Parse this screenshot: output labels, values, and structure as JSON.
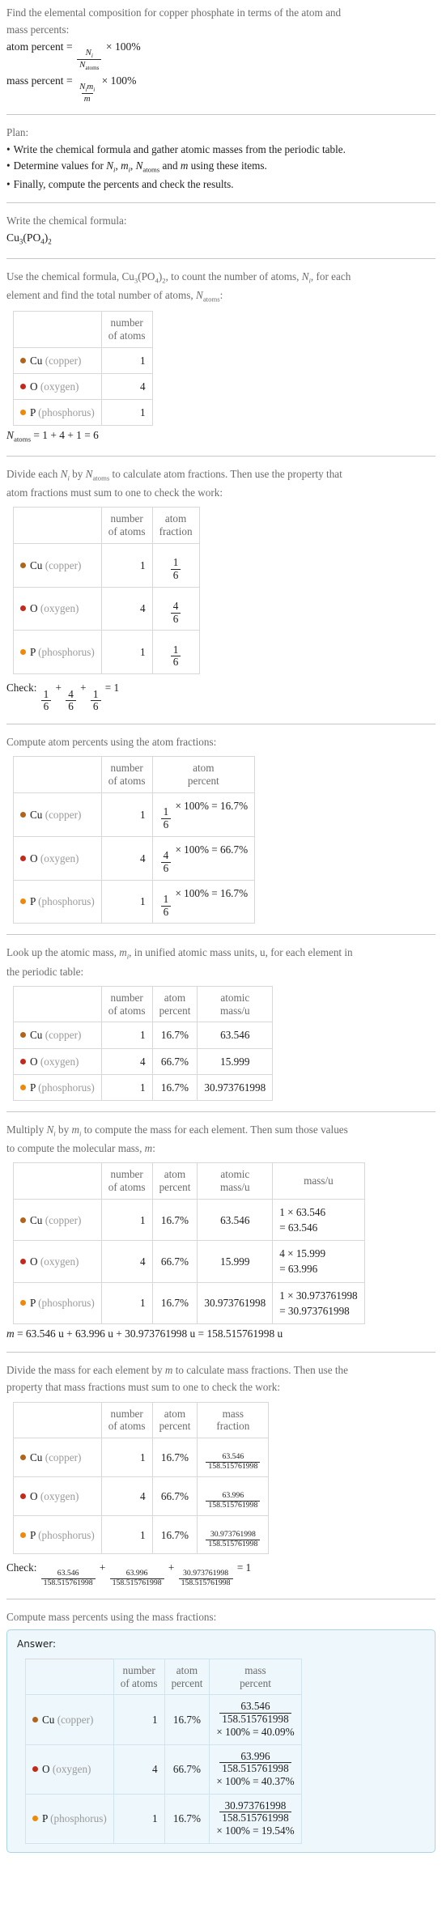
{
  "colors": {
    "cu": "#b0651b",
    "o": "#c32a1b",
    "p": "#ef8a09",
    "pod_bg": "#eef7fb",
    "pod_border": "#a8d4e4"
  },
  "intro": {
    "line1": "Find the elemental composition for copper phosphate in terms of the atom and",
    "line2": "mass percents:",
    "atom_percent_label": "atom percent",
    "mass_percent_label": "mass percent",
    "eq": "=",
    "times100": "× 100%",
    "atom_num": "N",
    "atom_num_sub": "i",
    "atom_den": "N",
    "atom_den_sub": "atoms",
    "mass_num": "N",
    "mass_num_sub": "i",
    "mass_num2": "m",
    "mass_num2_sub": "i",
    "mass_den": "m"
  },
  "plan": {
    "title": "Plan:",
    "items": [
      "Write the chemical formula and gather atomic masses from the periodic table.",
      "Determine values for Ni, mi, Natoms and m using these items.",
      "Finally, compute the percents and check the results."
    ],
    "item2_parts": {
      "a": "Determine values for ",
      "b": "N",
      "b_sub": "i",
      "c": ", ",
      "d": "m",
      "d_sub": "i",
      "e": ", ",
      "f": "N",
      "f_sub": "atoms",
      "g": " and ",
      "h": "m",
      "i": " using these items."
    }
  },
  "step_formula": {
    "prompt": "Write the chemical formula:",
    "formula_parts": [
      "Cu",
      "3",
      "(PO",
      "4",
      ")",
      "2"
    ]
  },
  "step_count": {
    "prompt_a": "Use the chemical formula, ",
    "prompt_b": ", to count the number of atoms, ",
    "prompt_c": ", for each",
    "prompt_d": "element and find the total number of atoms, ",
    "prompt_e": ":",
    "ni": "N",
    "ni_sub": "i",
    "natoms": "N",
    "natoms_sub": "atoms",
    "headers": [
      "",
      "number of atoms"
    ],
    "header_lines": [
      [
        "number",
        "of atoms"
      ]
    ],
    "rows": [
      {
        "dot": "cu",
        "sym": "Cu",
        "name": "(copper)",
        "count": "1"
      },
      {
        "dot": "o",
        "sym": "O",
        "name": "(oxygen)",
        "count": "4"
      },
      {
        "dot": "p",
        "sym": "P",
        "name": "(phosphorus)",
        "count": "1"
      }
    ],
    "total": "= 1 + 4 + 1 = 6",
    "total_sym": "N",
    "total_sym_sub": "atoms"
  },
  "step_fraction": {
    "prompt_a": "Divide each ",
    "prompt_b": " by ",
    "prompt_c": " to calculate atom fractions. Then use the property that",
    "prompt_d": "atom fractions must sum to one to check the work:",
    "ni": "N",
    "ni_sub": "i",
    "natoms": "N",
    "natoms_sub": "atoms",
    "header_atoms": [
      "number",
      "of atoms"
    ],
    "header_fraction": [
      "atom",
      "fraction"
    ],
    "rows": [
      {
        "dot": "cu",
        "sym": "Cu",
        "name": "(copper)",
        "count": "1",
        "num": "1",
        "den": "6"
      },
      {
        "dot": "o",
        "sym": "O",
        "name": "(oxygen)",
        "count": "4",
        "num": "4",
        "den": "6"
      },
      {
        "dot": "p",
        "sym": "P",
        "name": "(phosphorus)",
        "count": "1",
        "num": "1",
        "den": "6"
      }
    ],
    "check_label": "Check:",
    "check_terms": [
      {
        "num": "1",
        "den": "6"
      },
      {
        "num": "4",
        "den": "6"
      },
      {
        "num": "1",
        "den": "6"
      }
    ],
    "check_plus": "+",
    "check_result": "= 1"
  },
  "step_atom_percent": {
    "prompt": "Compute atom percents using the atom fractions:",
    "header_atoms": [
      "number",
      "of atoms"
    ],
    "header_percent": [
      "atom",
      "percent"
    ],
    "rows": [
      {
        "dot": "cu",
        "sym": "Cu",
        "name": "(copper)",
        "count": "1",
        "num": "1",
        "den": "6",
        "expr_tail": "× 100% = 16.7%"
      },
      {
        "dot": "o",
        "sym": "O",
        "name": "(oxygen)",
        "count": "4",
        "num": "4",
        "den": "6",
        "expr_tail": "× 100% = 66.7%"
      },
      {
        "dot": "p",
        "sym": "P",
        "name": "(phosphorus)",
        "count": "1",
        "num": "1",
        "den": "6",
        "expr_tail": "× 100% = 16.7%"
      }
    ]
  },
  "step_atomic_mass": {
    "prompt_a": "Look up the atomic mass, ",
    "prompt_b": ", in unified atomic mass units, u, for each element in",
    "prompt_c": "the periodic table:",
    "mi": "m",
    "mi_sub": "i",
    "header_atoms": [
      "number",
      "of atoms"
    ],
    "header_percent": [
      "atom",
      "percent"
    ],
    "header_mass": [
      "atomic",
      "mass/u"
    ],
    "rows": [
      {
        "dot": "cu",
        "sym": "Cu",
        "name": "(copper)",
        "count": "1",
        "percent": "16.7%",
        "mass": "63.546"
      },
      {
        "dot": "o",
        "sym": "O",
        "name": "(oxygen)",
        "count": "4",
        "percent": "66.7%",
        "mass": "15.999"
      },
      {
        "dot": "p",
        "sym": "P",
        "name": "(phosphorus)",
        "count": "1",
        "percent": "16.7%",
        "mass": "30.973761998"
      }
    ]
  },
  "step_mass": {
    "prompt_a": "Multiply ",
    "prompt_b": " by ",
    "prompt_c": " to compute the mass for each element. Then sum those values",
    "prompt_d": "to compute the molecular mass, ",
    "prompt_e": ":",
    "ni": "N",
    "ni_sub": "i",
    "mi": "m",
    "mi_sub": "i",
    "m": "m",
    "header_atoms": [
      "number",
      "of atoms"
    ],
    "header_percent": [
      "atom",
      "percent"
    ],
    "header_atomic": [
      "atomic",
      "mass/u"
    ],
    "header_massu": [
      "mass/u"
    ],
    "rows": [
      {
        "dot": "cu",
        "sym": "Cu",
        "name": "(copper)",
        "count": "1",
        "percent": "16.7%",
        "atomic": "63.546",
        "calc": "1 × 63.546",
        "calc2": "= 63.546"
      },
      {
        "dot": "o",
        "sym": "O",
        "name": "(oxygen)",
        "count": "4",
        "percent": "66.7%",
        "atomic": "15.999",
        "calc": "4 × 15.999",
        "calc2": "= 63.996"
      },
      {
        "dot": "p",
        "sym": "P",
        "name": "(phosphorus)",
        "count": "1",
        "percent": "16.7%",
        "atomic": "30.973761998",
        "calc": "1 × 30.973761998",
        "calc2": "= 30.973761998"
      }
    ],
    "total": "= 63.546 u + 63.996 u + 30.973761998 u = 158.515761998 u",
    "total_sym": "m"
  },
  "step_mass_fraction": {
    "prompt_a": "Divide the mass for each element by ",
    "prompt_b": " to calculate mass fractions. Then use the",
    "prompt_c": "property that mass fractions must sum to one to check the work:",
    "m": "m",
    "header_atoms": [
      "number",
      "of atoms"
    ],
    "header_percent": [
      "atom",
      "percent"
    ],
    "header_fraction": [
      "mass",
      "fraction"
    ],
    "rows": [
      {
        "dot": "cu",
        "sym": "Cu",
        "name": "(copper)",
        "count": "1",
        "percent": "16.7%",
        "num": "63.546",
        "den": "158.515761998"
      },
      {
        "dot": "o",
        "sym": "O",
        "name": "(oxygen)",
        "count": "4",
        "percent": "66.7%",
        "num": "63.996",
        "den": "158.515761998"
      },
      {
        "dot": "p",
        "sym": "P",
        "name": "(phosphorus)",
        "count": "1",
        "percent": "16.7%",
        "num": "30.973761998",
        "den": "158.515761998"
      }
    ],
    "check_label": "Check:",
    "check_terms": [
      {
        "num": "63.546",
        "den": "158.515761998"
      },
      {
        "num": "63.996",
        "den": "158.515761998"
      },
      {
        "num": "30.973761998",
        "den": "158.515761998"
      }
    ],
    "check_plus": "+",
    "check_result": "= 1"
  },
  "step_answer": {
    "prompt": "Compute mass percents using the mass fractions:",
    "answer_label": "Answer:",
    "header_atoms": [
      "number",
      "of atoms"
    ],
    "header_percent": [
      "atom",
      "percent"
    ],
    "header_masspct": [
      "mass",
      "percent"
    ],
    "rows": [
      {
        "dot": "cu",
        "sym": "Cu",
        "name": "(copper)",
        "count": "1",
        "percent": "16.7%",
        "num": "63.546",
        "den": "158.515761998",
        "tail": "× 100% = 40.09%"
      },
      {
        "dot": "o",
        "sym": "O",
        "name": "(oxygen)",
        "count": "4",
        "percent": "66.7%",
        "num": "63.996",
        "den": "158.515761998",
        "tail": "× 100% = 40.37%"
      },
      {
        "dot": "p",
        "sym": "P",
        "name": "(phosphorus)",
        "count": "1",
        "percent": "16.7%",
        "num": "30.973761998",
        "den": "158.515761998",
        "tail": "× 100% = 19.54%"
      }
    ]
  }
}
